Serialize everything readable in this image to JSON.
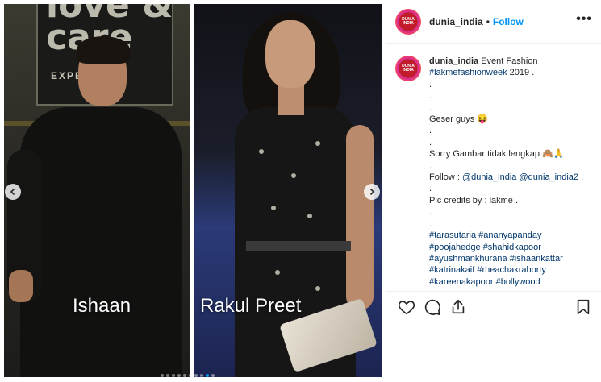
{
  "post": {
    "username": "dunia_india",
    "separator": "•",
    "follow_label": "Follow",
    "more_label": "•••",
    "avatar_text": "DUNIA INDIA"
  },
  "media": {
    "left_caption": "Ishaan",
    "right_caption": "Rakul Preet",
    "sign_text": "love & care",
    "sign_sub": "EXPER        SH",
    "carousel_dots": 10,
    "active_dot": 8
  },
  "caption": {
    "username": "dunia_india",
    "lines": [
      {
        "type": "mixed",
        "parts": [
          {
            "t": "Event Fashion",
            "k": "text"
          }
        ]
      },
      {
        "type": "mixed",
        "parts": [
          {
            "t": "#lakmefashionweek",
            "k": "hashtag"
          },
          {
            "t": " 2019 .",
            "k": "text"
          }
        ]
      },
      {
        "type": "text",
        "t": "."
      },
      {
        "type": "text",
        "t": "."
      },
      {
        "type": "text",
        "t": "."
      },
      {
        "type": "text",
        "t": "Geser guys 😝"
      },
      {
        "type": "text",
        "t": "."
      },
      {
        "type": "text",
        "t": "."
      },
      {
        "type": "text",
        "t": "Sorry Gambar tidak lengkap 🙈🙏"
      },
      {
        "type": "text",
        "t": "."
      },
      {
        "type": "mixed",
        "parts": [
          {
            "t": "Follow : ",
            "k": "text"
          },
          {
            "t": "@dunia_india",
            "k": "mention"
          },
          {
            "t": " ",
            "k": "text"
          },
          {
            "t": "@dunia_india2",
            "k": "mention"
          },
          {
            "t": " .",
            "k": "text"
          }
        ]
      },
      {
        "type": "text",
        "t": "."
      },
      {
        "type": "text",
        "t": "Pic credits by : lakme ."
      },
      {
        "type": "text",
        "t": "."
      },
      {
        "type": "text",
        "t": "."
      },
      {
        "type": "mixed",
        "parts": [
          {
            "t": "#tarasutaria",
            "k": "hashtag"
          },
          {
            "t": " ",
            "k": "text"
          },
          {
            "t": "#ananyapanday",
            "k": "hashtag"
          }
        ]
      },
      {
        "type": "mixed",
        "parts": [
          {
            "t": "#poojahedge",
            "k": "hashtag"
          },
          {
            "t": " ",
            "k": "text"
          },
          {
            "t": "#shahidkapoor",
            "k": "hashtag"
          }
        ]
      },
      {
        "type": "mixed",
        "parts": [
          {
            "t": "#ayushmankhurana",
            "k": "hashtag"
          },
          {
            "t": " ",
            "k": "text"
          },
          {
            "t": "#ishaankattar",
            "k": "hashtag"
          }
        ]
      },
      {
        "type": "mixed",
        "parts": [
          {
            "t": "#katrinakaif",
            "k": "hashtag"
          },
          {
            "t": " ",
            "k": "text"
          },
          {
            "t": "#rheachakraborty",
            "k": "hashtag"
          }
        ]
      },
      {
        "type": "mixed",
        "parts": [
          {
            "t": "#kareenakapoor",
            "k": "hashtag"
          },
          {
            "t": " ",
            "k": "text"
          },
          {
            "t": "#bollywood",
            "k": "hashtag"
          }
        ]
      }
    ]
  },
  "actions": {
    "like": "heart-icon",
    "comment": "comment-icon",
    "share": "share-icon",
    "save": "bookmark-icon"
  },
  "colors": {
    "link": "#00376b",
    "follow": "#0095f6",
    "border": "#efefef"
  }
}
